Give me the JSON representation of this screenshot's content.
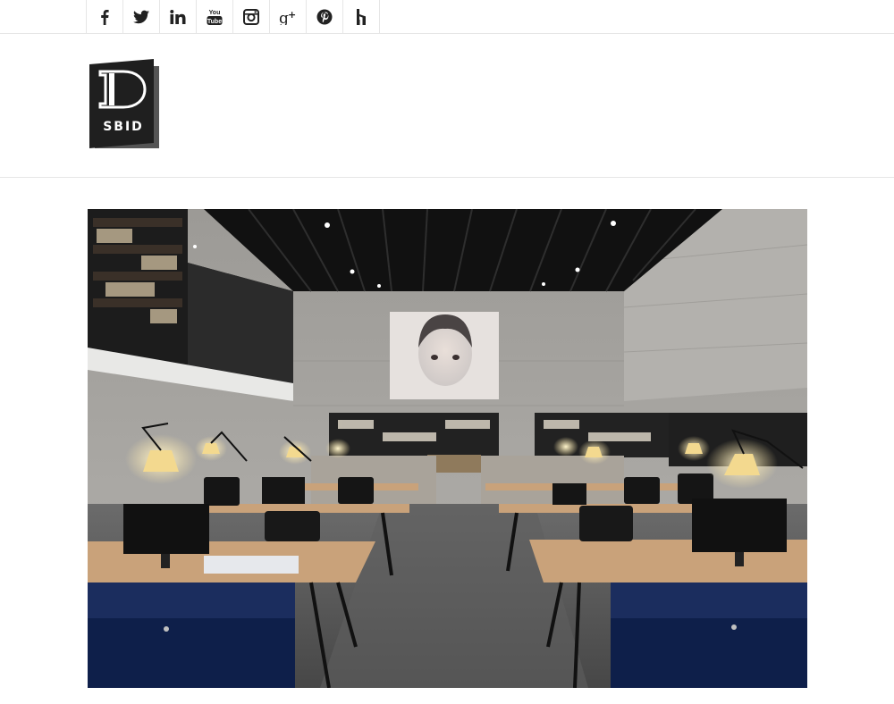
{
  "social": {
    "items": [
      {
        "name": "facebook-icon",
        "glyph": "f"
      },
      {
        "name": "twitter-icon",
        "glyph": "twitter"
      },
      {
        "name": "linkedin-icon",
        "glyph": "in"
      },
      {
        "name": "youtube-icon",
        "glyph": "YouTube"
      },
      {
        "name": "instagram-icon",
        "glyph": "instagram"
      },
      {
        "name": "google-plus-icon",
        "glyph": "g+"
      },
      {
        "name": "pinterest-icon",
        "glyph": "p"
      },
      {
        "name": "houzz-icon",
        "glyph": "houzz"
      }
    ]
  },
  "logo": {
    "letter": "D",
    "label": "SBID"
  },
  "hero": {
    "subject": "open-plan office interior photo",
    "colors": {
      "ceiling": "#141414",
      "concrete": "#a8a6a2",
      "floor": "#5b5b5b",
      "desk": "#c9a27a",
      "cabinet": "#0e1f4a",
      "lamp_glow": "#ffe9a8"
    }
  }
}
